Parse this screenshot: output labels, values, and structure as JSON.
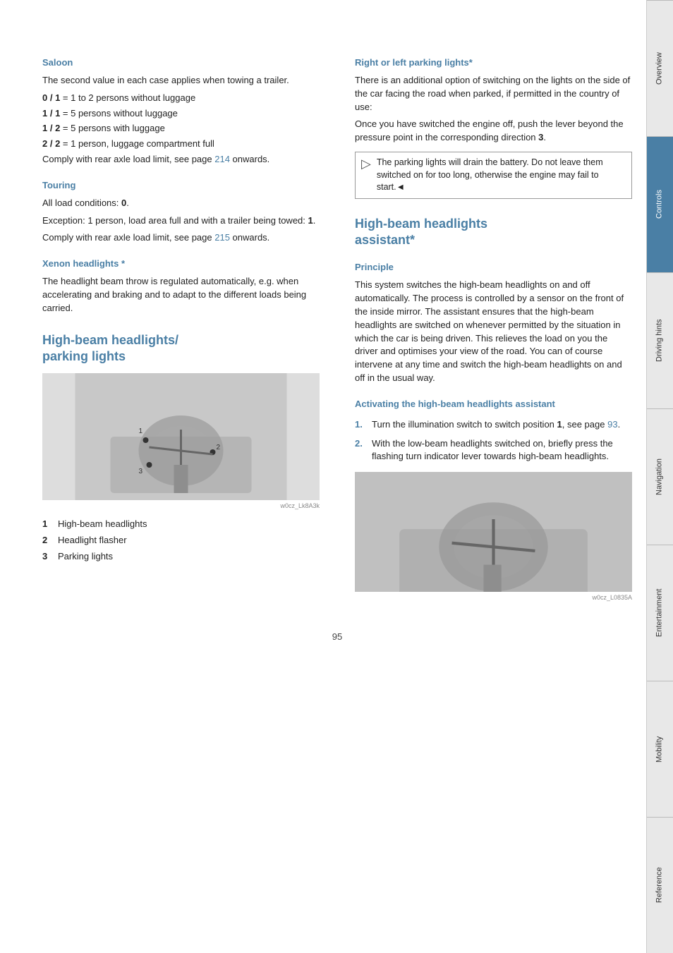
{
  "page": {
    "number": "95"
  },
  "sidebar": {
    "tabs": [
      {
        "id": "overview",
        "label": "Overview",
        "active": false
      },
      {
        "id": "controls",
        "label": "Controls",
        "active": true
      },
      {
        "id": "driving-hints",
        "label": "Driving hints",
        "active": false
      },
      {
        "id": "navigation",
        "label": "Navigation",
        "active": false
      },
      {
        "id": "entertainment",
        "label": "Entertainment",
        "active": false
      },
      {
        "id": "mobility",
        "label": "Mobility",
        "active": false
      },
      {
        "id": "reference",
        "label": "Reference",
        "active": false
      }
    ]
  },
  "left_col": {
    "saloon_heading": "Saloon",
    "saloon_intro": "The second value in each case applies when towing a trailer.",
    "saloon_items": [
      {
        "key": "0 / 1",
        "value": "= 1 to 2 persons without luggage"
      },
      {
        "key": "1 / 1",
        "value": "= 5 persons without luggage"
      },
      {
        "key": "1 / 2",
        "value": "= 5 persons with luggage"
      },
      {
        "key": "2 / 2",
        "value": "= 1 person, luggage compartment full"
      }
    ],
    "saloon_comply": "Comply with rear axle load limit, see page ",
    "saloon_comply_link": "214",
    "saloon_comply_suffix": " onwards.",
    "touring_heading": "Touring",
    "touring_text1": "All load conditions: ",
    "touring_bold1": "0",
    "touring_text1_suffix": ".",
    "touring_text2": "Exception: 1 person, load area full and with a trailer being towed: ",
    "touring_bold2": "1",
    "touring_text2_suffix": ".",
    "touring_comply": "Comply with rear axle load limit, see page ",
    "touring_comply_link": "215",
    "touring_comply_suffix": " onwards.",
    "xenon_heading": "Xenon headlights *",
    "xenon_text": "The headlight beam throw is regulated automatically, e.g. when accelerating and braking and to adapt to the different loads being carried.",
    "major_heading1_line1": "High-beam headlights/",
    "major_heading1_line2": "parking lights",
    "numbered_items": [
      {
        "num": "1",
        "label": "High-beam headlights"
      },
      {
        "num": "2",
        "label": "Headlight flasher"
      },
      {
        "num": "3",
        "label": "Parking lights"
      }
    ]
  },
  "right_col": {
    "parking_lights_heading": "Right or left parking lights*",
    "parking_lights_text1": "There is an additional option of switching on the lights on the side of the car facing the road when parked, if permitted in the country of use:",
    "parking_lights_text2": "Once you have switched the engine off, push the lever beyond the pressure point in the corresponding direction ",
    "parking_lights_bold": "3",
    "parking_lights_text2_suffix": ".",
    "note_text": "The parking lights will drain the battery. Do not leave them switched on for too long, otherwise the engine may fail to start.",
    "note_end": "◄",
    "major_heading2_line1": "High-beam headlights",
    "major_heading2_line2": "assistant*",
    "principle_heading": "Principle",
    "principle_text": "This system switches the high-beam headlights on and off automatically. The process is controlled by a sensor on the front of the inside mirror. The assistant ensures that the high-beam headlights are switched on whenever permitted by the situation in which the car is being driven. This relieves the load on you the driver and optimises your view of the road. You can of course intervene at any time and switch the high-beam headlights on and off in the usual way.",
    "activating_heading": "Activating the high-beam headlights assistant",
    "steps": [
      {
        "num": "1.",
        "text": "Turn the illumination switch to switch position ",
        "bold": "1",
        "suffix": ", see page ",
        "link": "93",
        "link_suffix": "."
      },
      {
        "num": "2.",
        "text": "With the low-beam headlights switched on, briefly press the flashing turn indicator lever towards high-beam headlights."
      }
    ]
  }
}
